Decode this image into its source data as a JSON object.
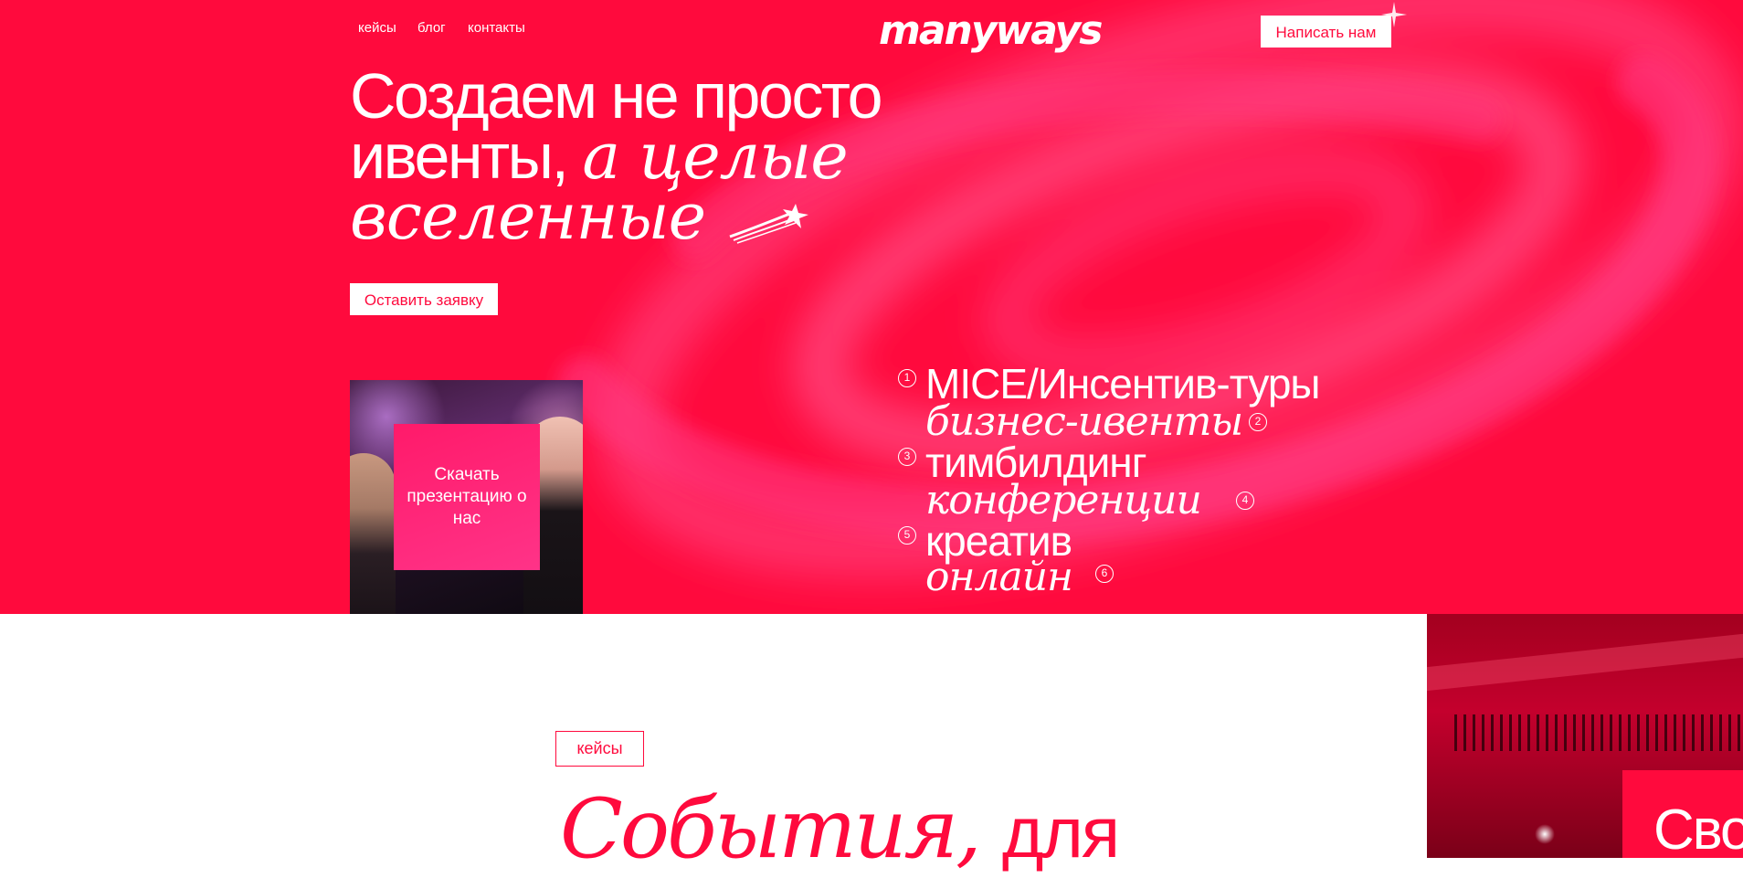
{
  "nav": {
    "links": [
      "кейсы",
      "блог",
      "контакты"
    ],
    "logo": "manyways",
    "write_button": "Написать нам"
  },
  "hero": {
    "headline_line1": "Создаем не просто",
    "headline_line2_regular": "ивенты,",
    "headline_line2_italic": "а целые",
    "headline_line3_italic": "вселенные",
    "cta_button": "Оставить заявку",
    "download_card": "Скачать презентацию о нас"
  },
  "services": [
    {
      "num": "1",
      "label": "MICE/Инсентив-туры"
    },
    {
      "num": "2",
      "label": "бизнес-ивенты"
    },
    {
      "num": "3",
      "label": "тимбилдинг"
    },
    {
      "num": "4",
      "label": "конференции"
    },
    {
      "num": "5",
      "label": "креатив"
    },
    {
      "num": "6",
      "label": "онлайн"
    }
  ],
  "cases_section": {
    "tag": "кейсы",
    "title_italic": "События,",
    "title_regular": "для",
    "card_text": "Сво"
  },
  "colors": {
    "brand": "#ff0a3d",
    "white": "#ffffff"
  },
  "icons": [
    "sparkle-icon",
    "comet-icon",
    "number-circle-icon"
  ]
}
